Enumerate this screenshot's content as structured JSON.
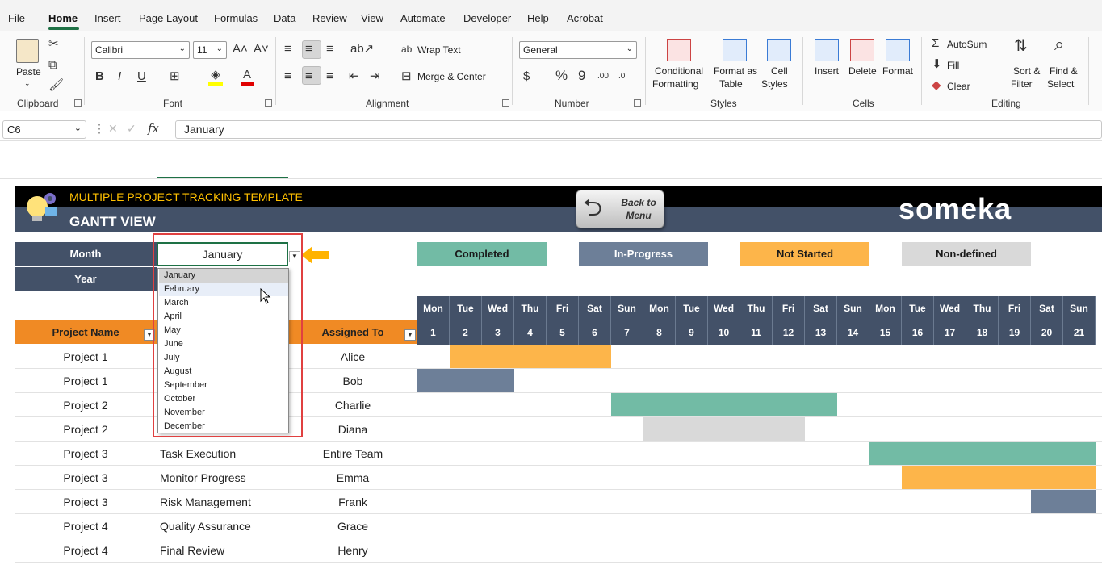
{
  "menu": {
    "items": [
      "File",
      "Home",
      "Insert",
      "Page Layout",
      "Formulas",
      "Data",
      "Review",
      "View",
      "Automate",
      "Developer",
      "Help",
      "Acrobat"
    ],
    "active": "Home"
  },
  "ribbon": {
    "clipboard": {
      "paste": "Paste",
      "group": "Clipboard"
    },
    "font": {
      "name": "Calibri",
      "size": "11",
      "group": "Font"
    },
    "alignment": {
      "wrap": "Wrap Text",
      "merge": "Merge & Center",
      "group": "Alignment"
    },
    "number": {
      "format": "General",
      "group": "Number"
    },
    "styles": {
      "cond1": "Conditional",
      "cond2": "Formatting",
      "fmt1": "Format as",
      "fmt2": "Table",
      "cell1": "Cell",
      "cell2": "Styles",
      "group": "Styles"
    },
    "cells": {
      "insert": "Insert",
      "delete": "Delete",
      "format": "Format",
      "group": "Cells"
    },
    "editing": {
      "autosum": "AutoSum",
      "fill": "Fill",
      "clear": "Clear",
      "sort1": "Sort &",
      "sort2": "Filter",
      "find1": "Find &",
      "find2": "Select",
      "group": "Editing"
    }
  },
  "formula_bar": {
    "cell_ref": "C6",
    "value": "January"
  },
  "header": {
    "template_title": "MULTIPLE PROJECT TRACKING TEMPLATE",
    "view_title": "GANTT VIEW",
    "back_button": "Back to Menu",
    "logo": "someka"
  },
  "controls": {
    "month_label": "Month",
    "year_label": "Year",
    "month_value": "January"
  },
  "legend": [
    {
      "label": "Completed",
      "color": "#72bba5"
    },
    {
      "label": "In-Progress",
      "color": "#6d7f98"
    },
    {
      "label": "Not Started",
      "color": "#fdb54a"
    },
    {
      "label": "Non-defined",
      "color": "#d9d9d9"
    }
  ],
  "calendar": {
    "days": [
      "Mon",
      "Tue",
      "Wed",
      "Thu",
      "Fri",
      "Sat",
      "Sun",
      "Mon",
      "Tue",
      "Wed",
      "Thu",
      "Fri",
      "Sat",
      "Sun",
      "Mon",
      "Tue",
      "Wed",
      "Thu",
      "Fri",
      "Sat",
      "Sun"
    ],
    "dates": [
      "1",
      "2",
      "3",
      "4",
      "5",
      "6",
      "7",
      "8",
      "9",
      "10",
      "11",
      "12",
      "13",
      "14",
      "15",
      "16",
      "17",
      "18",
      "19",
      "20",
      "21"
    ]
  },
  "columns": {
    "project": "Project Name",
    "assigned": "Assigned To"
  },
  "rows": [
    {
      "project": "Project 1",
      "task": "",
      "assigned": "Alice",
      "status": "Not Started",
      "start": 2,
      "end": 6
    },
    {
      "project": "Project 1",
      "task": "",
      "assigned": "Bob",
      "status": "In-Progress",
      "start": 1,
      "end": 3
    },
    {
      "project": "Project 2",
      "task": "",
      "assigned": "Charlie",
      "status": "Completed",
      "start": 7,
      "end": 13
    },
    {
      "project": "Project 2",
      "task": "",
      "assigned": "Diana",
      "status": "Non-defined",
      "start": 8,
      "end": 12
    },
    {
      "project": "Project 3",
      "task": "Task Execution",
      "assigned": "Entire Team",
      "status": "Completed",
      "start": 15,
      "end": 21
    },
    {
      "project": "Project 3",
      "task": "Monitor Progress",
      "assigned": "Emma",
      "status": "Not Started",
      "start": 16,
      "end": 21
    },
    {
      "project": "Project 3",
      "task": "Risk Management",
      "assigned": "Frank",
      "status": "In-Progress",
      "start": 20,
      "end": 21
    },
    {
      "project": "Project 4",
      "task": "Quality Assurance",
      "assigned": "Grace",
      "status": "",
      "start": 0,
      "end": 0
    },
    {
      "project": "Project 4",
      "task": "Final Review",
      "assigned": "Henry",
      "status": "",
      "start": 0,
      "end": 0
    }
  ],
  "month_dropdown": {
    "options": [
      "January",
      "February",
      "March",
      "April",
      "May",
      "June",
      "July",
      "August",
      "September",
      "October",
      "November",
      "December"
    ],
    "selected": "January",
    "hovered": "February"
  }
}
